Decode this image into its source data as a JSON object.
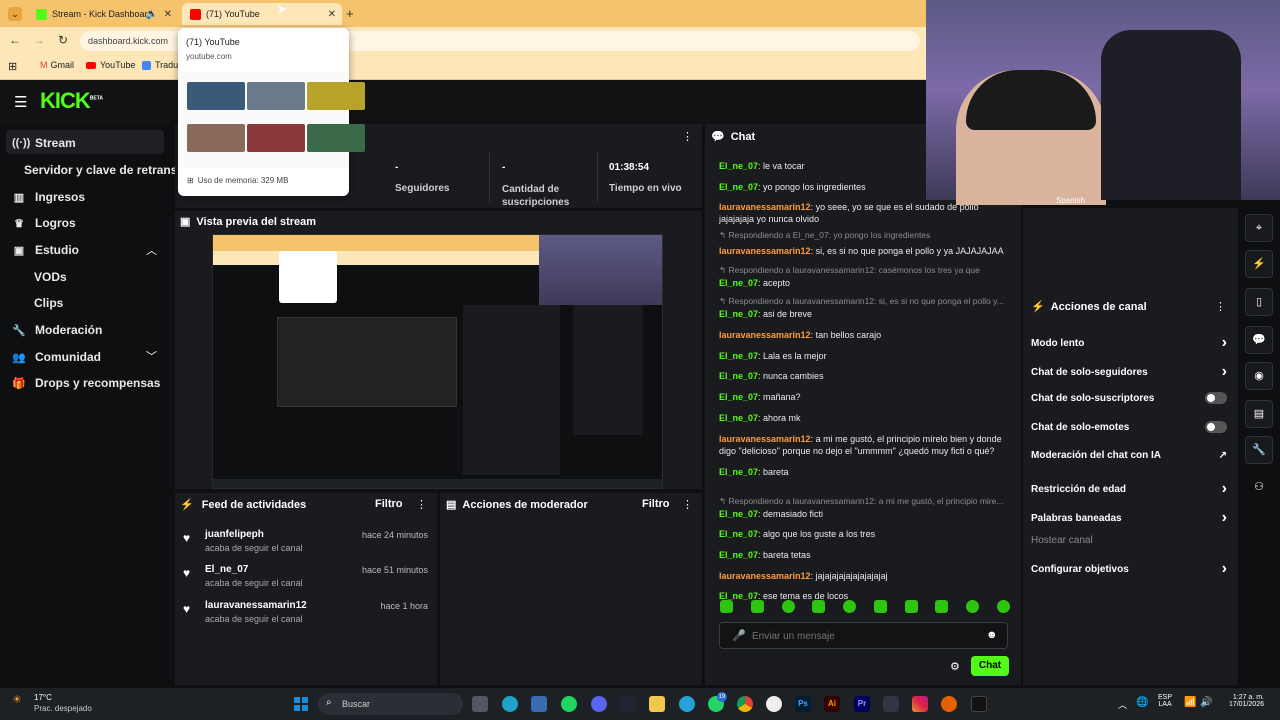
{
  "browser": {
    "tabs": [
      {
        "title": "Stream - Kick Dashboard",
        "active": true
      },
      {
        "title": "(71) YouTube",
        "active": false
      }
    ],
    "url": "dashboard.kick.com",
    "bookmarks": [
      "Gmail",
      "YouTube",
      "Traduc"
    ],
    "tab_preview": {
      "title": "(71) YouTube",
      "domain": "youtube.com",
      "memory": "Uso de memoria: 329 MB"
    }
  },
  "kick": {
    "logo": "KICK",
    "logo_badge": "BETA",
    "sidebar": [
      {
        "label": "Stream",
        "icon": "broadcast-icon"
      },
      {
        "label": "Servidor y clave de retransm",
        "sub": true
      },
      {
        "label": "Ingresos",
        "icon": "bar-chart-icon"
      },
      {
        "label": "Logros",
        "icon": "trophy-icon"
      },
      {
        "label": "Estudio",
        "icon": "video-icon"
      },
      {
        "label": "VODs",
        "sub": true
      },
      {
        "label": "Clips",
        "sub": true
      },
      {
        "label": "Moderación",
        "icon": "wrench-icon"
      },
      {
        "label": "Comunidad",
        "icon": "users-icon"
      },
      {
        "label": "Drops y recompensas",
        "icon": "gift-icon"
      }
    ],
    "stats": [
      {
        "value": "-",
        "label": "Seguidores"
      },
      {
        "value": "-",
        "label": "Cantidad de suscripciones"
      },
      {
        "value": "01:38:54",
        "label": "Tiempo en vivo"
      }
    ],
    "preview_title": "Vista previa del stream",
    "feed": {
      "title": "Feed de actividades",
      "filter": "Filtro",
      "items": [
        {
          "user": "juanfelipeph",
          "action": "acaba de seguir el canal",
          "time": "hace 24 minutos"
        },
        {
          "user": "El_ne_07",
          "action": "acaba de seguir el canal",
          "time": "hace 51 minutos"
        },
        {
          "user": "lauravanessamarin12",
          "action": "acaba de seguir el canal",
          "time": "hace 1 hora"
        }
      ]
    },
    "mod_actions": {
      "title": "Acciones de moderador",
      "filter": "Filtro"
    },
    "chat": {
      "title": "Chat",
      "messages": [
        {
          "user": "El_ne_07",
          "text": ": le va tocar",
          "kind": "green"
        },
        {
          "user": "El_ne_07",
          "text": ": yo pongo los ingredientes",
          "kind": "green"
        },
        {
          "user": "lauravanessamarin12",
          "text": ": yo seee, yo se que es el sudado de pollo jajajajaja yo nunca olvido",
          "kind": "orange"
        },
        {
          "reply": "Respondiendo a El_ne_07: yo pongo los ingredientes"
        },
        {
          "user": "lauravanessamarin12",
          "text": ": si, es si no que ponga el pollo y ya JAJAJAJAA",
          "kind": "orange"
        },
        {
          "reply": "Respondiendo a lauravanessamarin12: casémonos los tres ya que"
        },
        {
          "user": "El_ne_07",
          "text": ": acepto",
          "kind": "green"
        },
        {
          "reply": "Respondiendo a lauravanessamarin12: si, es si no que ponga el pollo y..."
        },
        {
          "user": "El_ne_07",
          "text": ": asi de breve",
          "kind": "green"
        },
        {
          "user": "lauravanessamarin12",
          "text": ": tan bellos carajo",
          "kind": "orange"
        },
        {
          "user": "El_ne_07",
          "text": ": Lala es la mejor",
          "kind": "green"
        },
        {
          "user": "El_ne_07",
          "text": ": nunca cambies",
          "kind": "green"
        },
        {
          "user": "El_ne_07",
          "text": ": mañana?",
          "kind": "green"
        },
        {
          "user": "El_ne_07",
          "text": ": ahora mk",
          "kind": "green"
        },
        {
          "user": "lauravanessamarin12",
          "text": ": a mi me gustó, el principio mírelo bien y donde digo \"delicioso\" porque no dejo el \"ummmm\" ¿quedó muy ficti o qué?",
          "kind": "orange"
        },
        {
          "user": "El_ne_07",
          "text": ": bareta",
          "kind": "green"
        },
        {
          "reply": "Respondiendo a lauravanessamarin12: a mi me gustó, el principio mire..."
        },
        {
          "user": "El_ne_07",
          "text": ": demasiado ficti",
          "kind": "green"
        },
        {
          "user": "El_ne_07",
          "text": ": algo que los guste a los tres",
          "kind": "green"
        },
        {
          "user": "El_ne_07",
          "text": ": bareta tetas",
          "kind": "green"
        },
        {
          "user": "lauravanessamarin12",
          "text": ": jajajajajajajajajajaj",
          "kind": "orange"
        },
        {
          "user": "El_ne_07",
          "text": ": ese tema es de locos",
          "kind": "green"
        }
      ],
      "placeholder": "Enviar un mensaje",
      "send": "Chat"
    },
    "channel_actions": {
      "title": "Acciones de canal",
      "items": [
        {
          "label": "Modo lento",
          "control": "chevron"
        },
        {
          "label": "Chat de solo-seguidores",
          "control": "chevron"
        },
        {
          "label": "Chat de solo-suscriptores",
          "control": "toggle"
        },
        {
          "label": "Chat de solo-emotes",
          "control": "toggle"
        },
        {
          "label": "Moderación del chat con IA",
          "control": "external"
        },
        {
          "label": "Restricción de edad",
          "control": "chevron"
        },
        {
          "label": "Palabras baneadas",
          "control": "chevron"
        },
        {
          "label": "Hostear canal",
          "control": "none"
        },
        {
          "label": "Configurar objetivos",
          "control": "chevron"
        }
      ]
    },
    "webcam_label": "Spanish"
  },
  "taskbar": {
    "weather_temp": "17°C",
    "weather_desc": "Prac. despejado",
    "search": "Buscar",
    "lang": "ESP",
    "lang2": "LAA",
    "time": "1:27 a. m.",
    "date": "17/01/2026",
    "badge": "19"
  }
}
